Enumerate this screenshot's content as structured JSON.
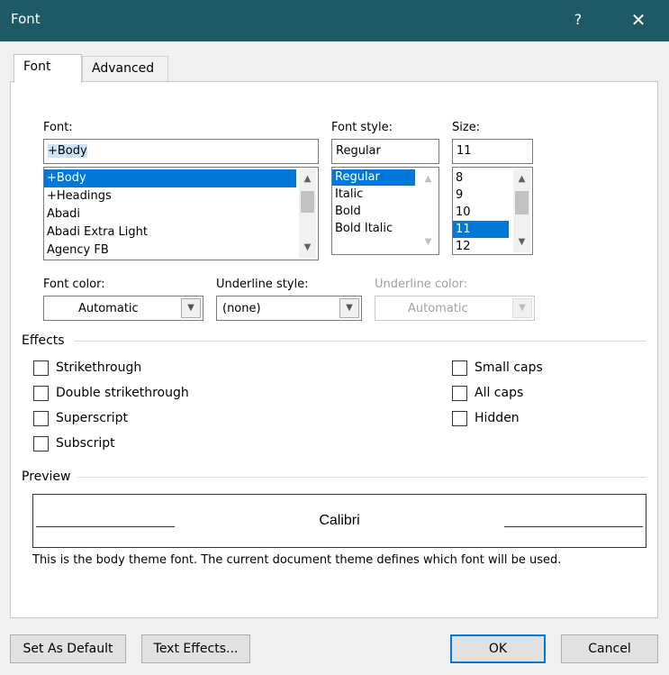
{
  "window": {
    "title": "Font",
    "help": "?",
    "close": "✕"
  },
  "tabs": [
    {
      "label": "Font",
      "active": true
    },
    {
      "label": "Advanced",
      "active": false
    }
  ],
  "font": {
    "label": "Font:",
    "value": "+Body",
    "items": [
      "+Body",
      "+Headings",
      "Abadi",
      "Abadi Extra Light",
      "Agency FB"
    ],
    "selected": "+Body"
  },
  "font_style": {
    "label": "Font style:",
    "value": "Regular",
    "items": [
      "Regular",
      "Italic",
      "Bold",
      "Bold Italic"
    ],
    "selected": "Regular"
  },
  "size": {
    "label": "Size:",
    "value": "11",
    "items": [
      "8",
      "9",
      "10",
      "11",
      "12"
    ],
    "selected": "11"
  },
  "font_color": {
    "label": "Font color:",
    "value": "Automatic"
  },
  "underline_style": {
    "label": "Underline style:",
    "value": "(none)"
  },
  "underline_color": {
    "label": "Underline color:",
    "value": "Automatic",
    "enabled": false
  },
  "effects": {
    "label": "Effects",
    "left": [
      {
        "label": "Strikethrough",
        "checked": false
      },
      {
        "label": "Double strikethrough",
        "checked": false
      },
      {
        "label": "Superscript",
        "checked": false
      },
      {
        "label": "Subscript",
        "checked": false
      }
    ],
    "right": [
      {
        "label": "Small caps",
        "checked": false
      },
      {
        "label": "All caps",
        "checked": false
      },
      {
        "label": "Hidden",
        "checked": false
      }
    ]
  },
  "preview": {
    "label": "Preview",
    "sample": "Calibri",
    "description": "This is the body theme font. The current document theme defines which font will be used."
  },
  "buttons": {
    "set_default": "Set As Default",
    "text_effects": "Text Effects...",
    "ok": "OK",
    "cancel": "Cancel"
  },
  "colors": {
    "titlebar": "#1e5a66",
    "selection": "#0078d7",
    "default_button_border": "#0078d7"
  }
}
